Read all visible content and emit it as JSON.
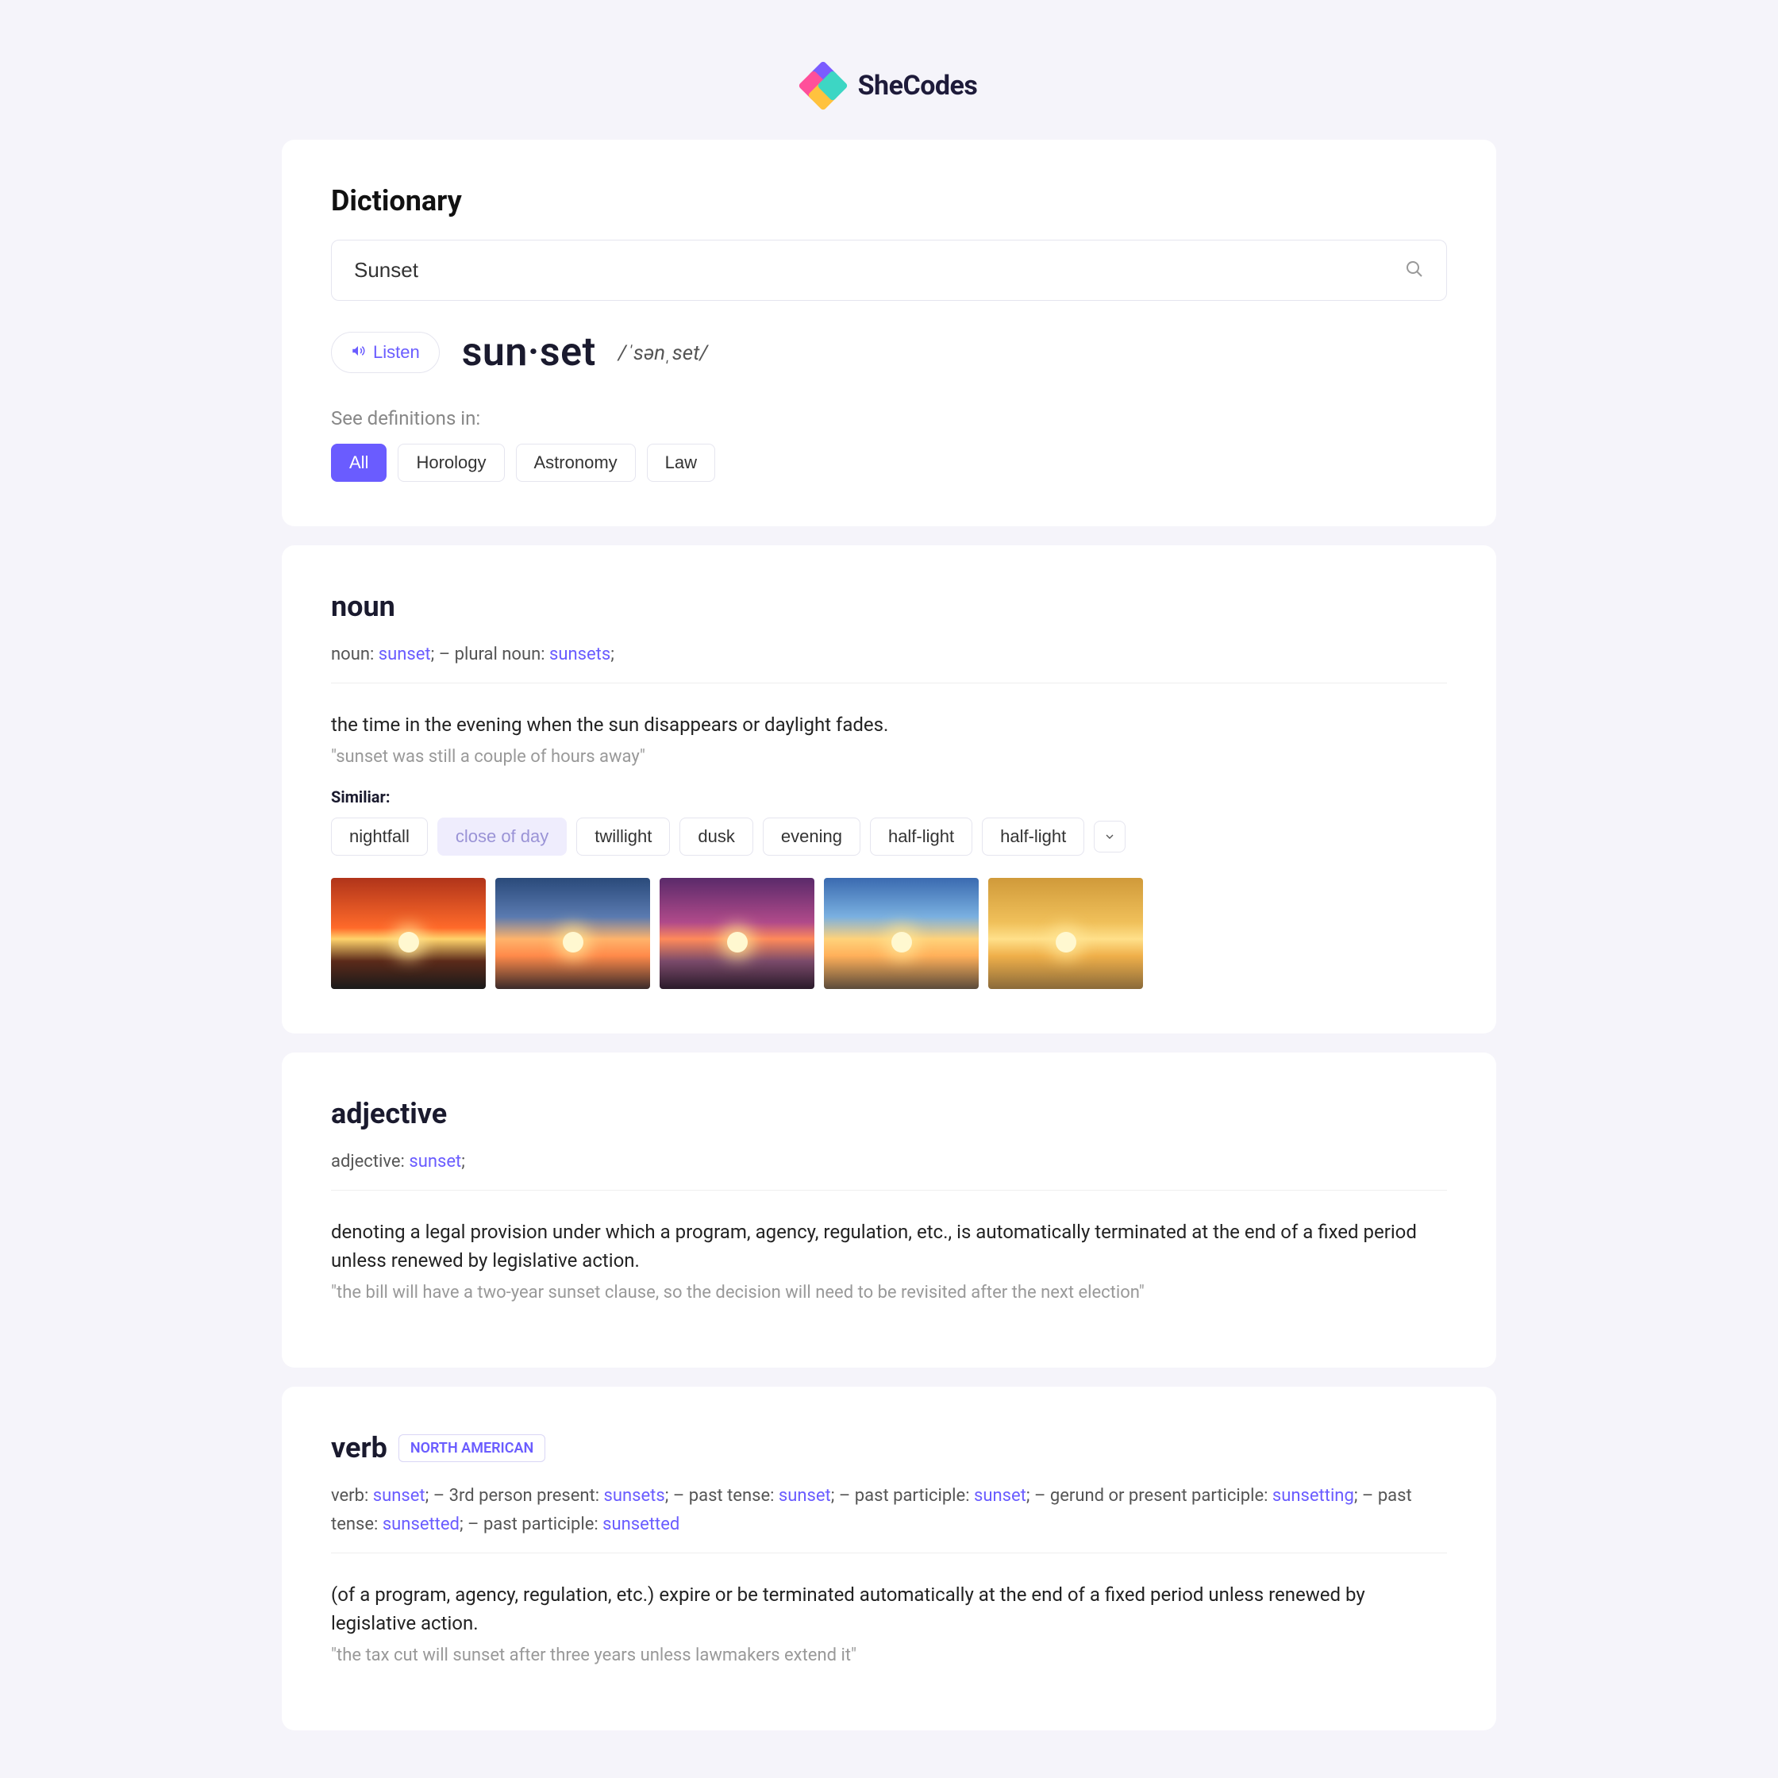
{
  "brand": "SheCodes",
  "header": {
    "title": "Dictionary",
    "search_value": "Sunset",
    "listen_label": "Listen",
    "word_display": "sun·set",
    "phonetic": "/ˈsənˌset/",
    "see_def_label": "See definitions in:",
    "categories": [
      {
        "label": "All",
        "active": true
      },
      {
        "label": "Horology",
        "active": false
      },
      {
        "label": "Astronomy",
        "active": false
      },
      {
        "label": "Law",
        "active": false
      }
    ]
  },
  "entries": [
    {
      "pos": "noun",
      "region": "",
      "forms_parts": [
        {
          "t": "plain",
          "v": "noun: "
        },
        {
          "t": "hl",
          "v": "sunset"
        },
        {
          "t": "plain",
          "v": ";   –   plural noun: "
        },
        {
          "t": "hl",
          "v": "sunsets"
        },
        {
          "t": "plain",
          "v": ";"
        }
      ],
      "definition": "the time in the evening when the sun disappears or daylight fades.",
      "example": "\"sunset was still a couple of hours away\"",
      "similar_label": "Similiar:",
      "similar": [
        {
          "label": "nightfall",
          "soft": false
        },
        {
          "label": "close of day",
          "soft": true
        },
        {
          "label": "twillight",
          "soft": false
        },
        {
          "label": "dusk",
          "soft": false
        },
        {
          "label": "evening",
          "soft": false
        },
        {
          "label": "half-light",
          "soft": false
        },
        {
          "label": "half-light",
          "soft": false
        }
      ],
      "has_images": true
    },
    {
      "pos": "adjective",
      "region": "",
      "forms_parts": [
        {
          "t": "plain",
          "v": "adjective: "
        },
        {
          "t": "hl",
          "v": "sunset"
        },
        {
          "t": "plain",
          "v": ";"
        }
      ],
      "definition": "denoting a legal provision under which a program, agency, regulation, etc., is automatically terminated at the end of a fixed period unless renewed by legislative action.",
      "example": "\"the bill will have a two-year sunset clause, so the decision will need to be revisited after the next election\"",
      "similar_label": "",
      "similar": [],
      "has_images": false
    },
    {
      "pos": "verb",
      "region": "NORTH AMERICAN",
      "forms_parts": [
        {
          "t": "plain",
          "v": "verb: "
        },
        {
          "t": "hl",
          "v": "sunset"
        },
        {
          "t": "plain",
          "v": ";   –   3rd person present: "
        },
        {
          "t": "hl",
          "v": "sunsets"
        },
        {
          "t": "plain",
          "v": ";   –   past tense: "
        },
        {
          "t": "hl",
          "v": "sunset"
        },
        {
          "t": "plain",
          "v": ";   –   past participle: "
        },
        {
          "t": "hl",
          "v": "sunset"
        },
        {
          "t": "plain",
          "v": ";   –   gerund or present participle: "
        },
        {
          "t": "hl",
          "v": "sunsetting"
        },
        {
          "t": "plain",
          "v": ";   –   past tense: "
        },
        {
          "t": "hl",
          "v": "sunsetted"
        },
        {
          "t": "plain",
          "v": ";   –   past participle: "
        },
        {
          "t": "hl",
          "v": "sunsetted"
        }
      ],
      "definition": "(of a program, agency, regulation, etc.) expire or be terminated automatically at the end of a fixed period unless renewed by legislative action.",
      "example": "\"the tax cut will sunset after three years unless lawmakers extend it\"",
      "similar_label": "",
      "similar": [],
      "has_images": false
    }
  ]
}
